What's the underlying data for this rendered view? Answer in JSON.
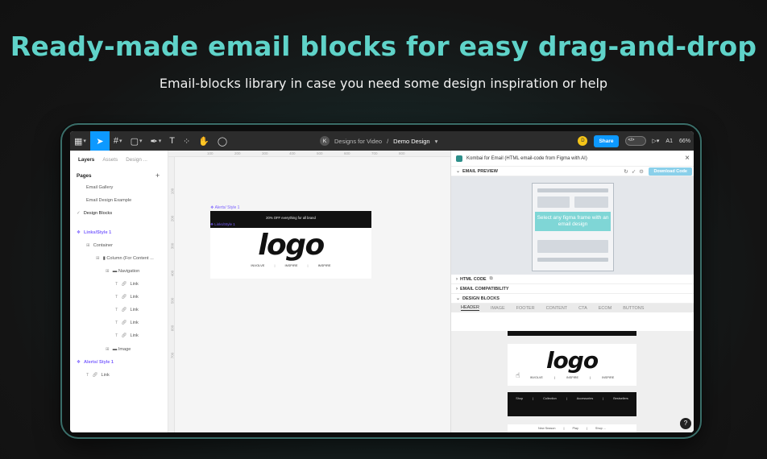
{
  "hero": {
    "title": "Ready-made email blocks for easy drag-and-drop",
    "subtitle": "Email-blocks library in case you need some design inspiration or help"
  },
  "toolbar": {
    "user_initial": "K",
    "project": "Designs for Video",
    "separator": "/",
    "document": "Demo Design",
    "collab_initial": "D",
    "share_label": "Share",
    "ai_label": "A1",
    "zoom": "66%"
  },
  "layers": {
    "tabs": [
      "Layers",
      "Assets",
      "Design ..."
    ],
    "pages_label": "Pages",
    "pages": [
      "Email Gallery",
      "Email Design Example",
      "Design Blocks"
    ],
    "tree": [
      "Links/Style 1",
      "Container",
      "Column (For Content ...",
      "Navigation",
      "Link",
      "Link",
      "Link",
      "Link",
      "Link",
      "Image",
      "Alerts/ Style 1",
      "Link"
    ]
  },
  "canvas": {
    "ruler_top": [
      "100",
      "200",
      "300",
      "400",
      "500",
      "600",
      "700",
      "800"
    ],
    "ruler_left": [
      "100",
      "200",
      "300",
      "400",
      "500",
      "600",
      "700"
    ],
    "frame_label": "Alerts/ Style 1",
    "sub_label": "Links/Style 1",
    "alert_text": "20% OFF everything for all brand",
    "logo": "logo",
    "nav": [
      "INVOLVE",
      "|",
      "INSPIRE",
      "|",
      "INSPIRE"
    ]
  },
  "plugin": {
    "title": "Kombai for Email (HTML email-code from Figma with AI)",
    "email_preview": "EMAIL PREVIEW",
    "download_label": "Download Code",
    "callout": "Select any figma frame with an email design",
    "html_code": "HTML CODE",
    "compat": "EMAIL COMPATIBILITY",
    "design_blocks": "DESIGN BLOCKS",
    "tabs": [
      "HEADER",
      "IMAGE",
      "FOOTER",
      "CONTENT",
      "CTA",
      "ECOM",
      "BUTTONS"
    ],
    "block_logo": "logo",
    "block_nav": [
      "INVOLVE",
      "|",
      "INSPIRE",
      "|",
      "INSPIRE"
    ],
    "dark_nav": [
      "Shop",
      "|",
      "Collection",
      "|",
      "Accessories",
      "|",
      "Bestsellers"
    ],
    "light_nav": [
      "New Season",
      "|",
      "Play",
      "|",
      "Shop ..."
    ],
    "help": "?"
  }
}
